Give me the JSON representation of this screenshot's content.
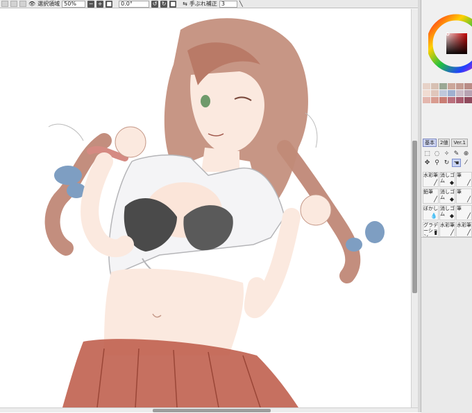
{
  "toolbar": {
    "selection_label": "選択領域",
    "zoom_value": "50%",
    "minus": "−",
    "plus": "+",
    "rotation_value": "0.0°",
    "stabilizer_label": "手ぶれ補正",
    "stabilizer_value": "3"
  },
  "tool_panel": {
    "tabs": [
      "基本",
      "2値",
      "Ver.1"
    ],
    "active_tab": "基本",
    "brushes": [
      "水彩筆",
      "消しゴム",
      "筆",
      "鉛筆",
      "消しゴム",
      "筆",
      "ぼかし",
      "消しゴム",
      "筆",
      "グラデーション",
      "水彩筆",
      "水彩筆"
    ]
  },
  "colors": {
    "accent": "#7a86c0",
    "panel_bg": "#f0f0f0",
    "hair": "#b97a67",
    "skirt": "#c0604f",
    "bow": "#7e9ec2",
    "bra": "#4a4a4a"
  },
  "swatch_colors": [
    "#e7d2c8",
    "#d7c0b3",
    "#9aa894",
    "#cba79a",
    "#c49c92",
    "#b98c86",
    "#f1dcd2",
    "#e0c6bb",
    "#bfc8dc",
    "#9fb0d0",
    "#cbbbc7",
    "#b7a3b3",
    "#e4b7ae",
    "#d99c90",
    "#c97d74",
    "#b96f7c",
    "#a85b6e",
    "#8f4a5d"
  ]
}
